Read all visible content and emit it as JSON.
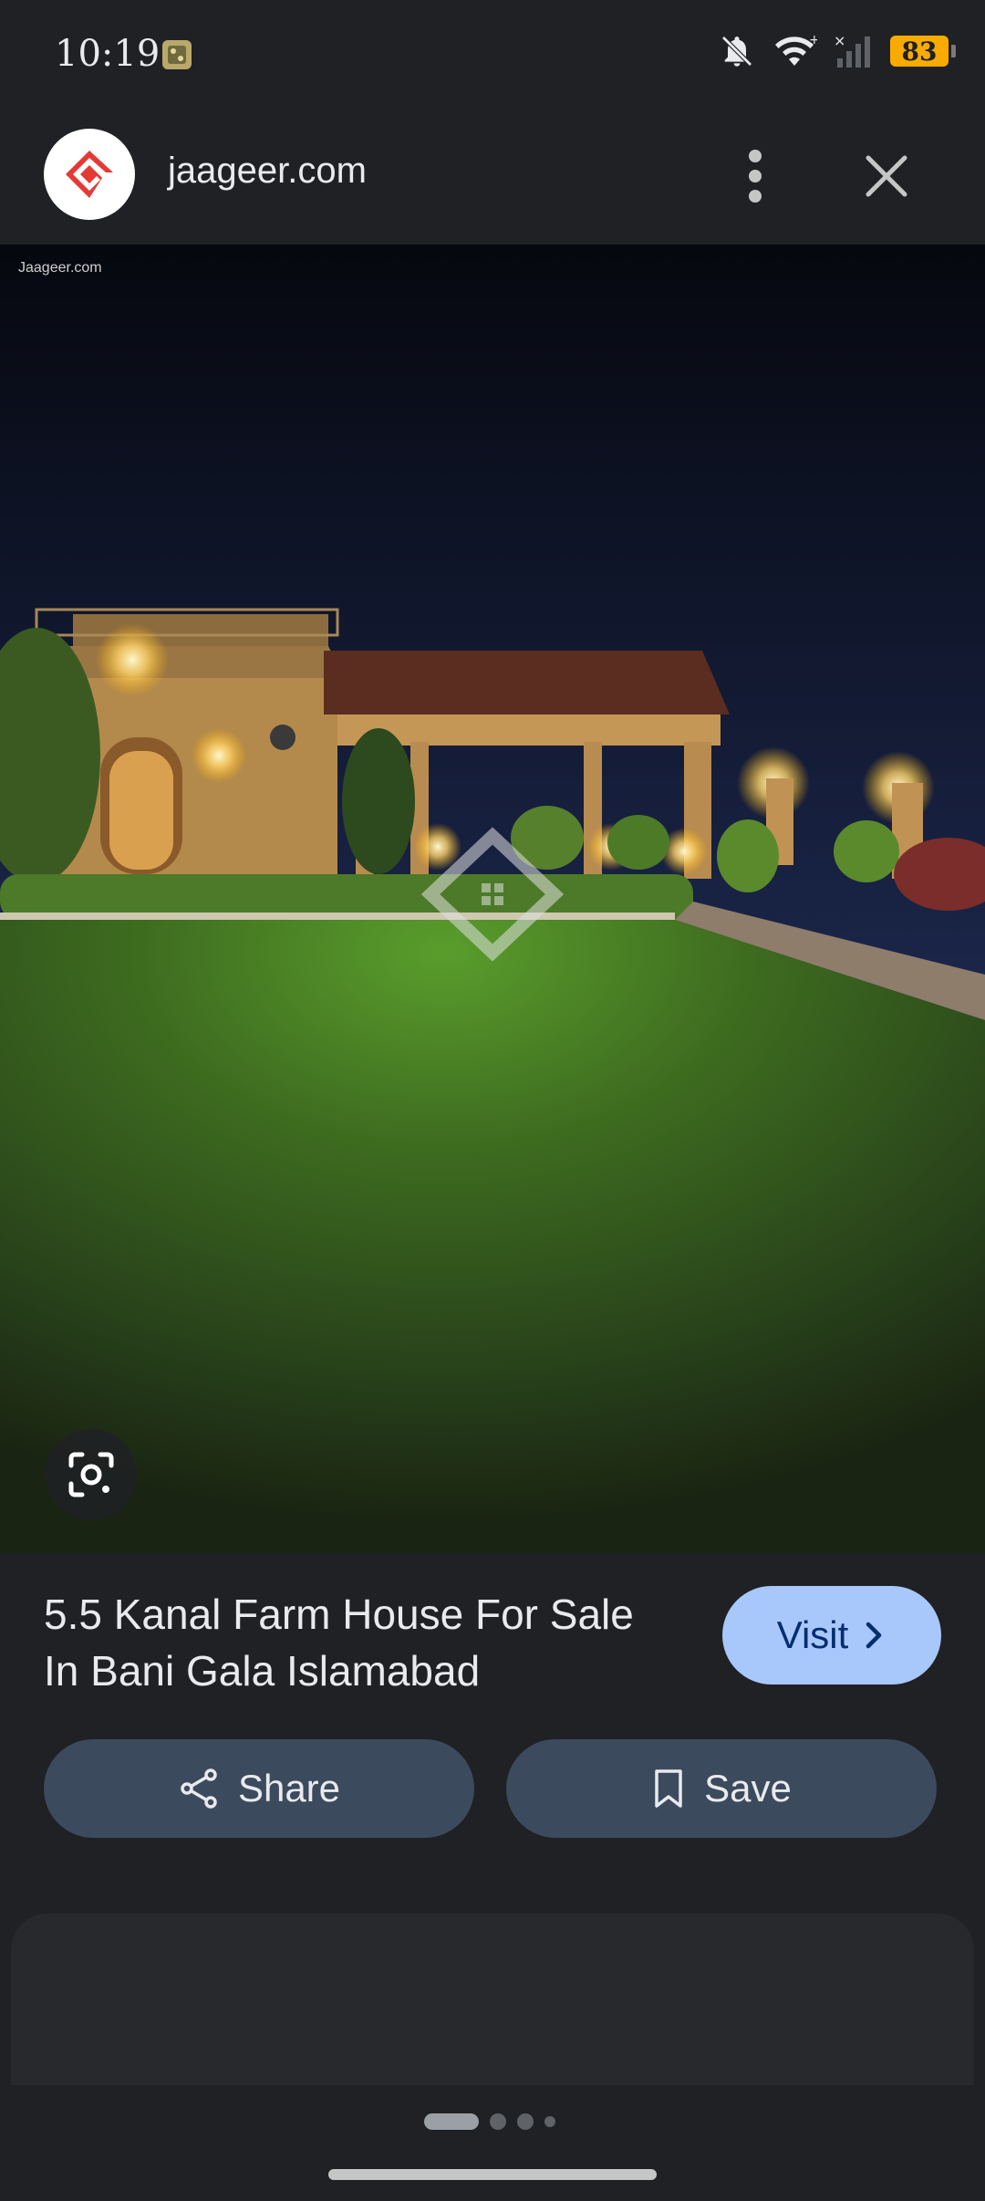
{
  "status_bar": {
    "time": "10:19",
    "battery": "83",
    "icons": [
      "notifications-muted-icon",
      "wifi-icon",
      "signal-off-icon",
      "battery-icon"
    ]
  },
  "header": {
    "site_name": "jaageer.com",
    "logo_icon": "jaageer-logo",
    "more_icon": "more-vert-icon",
    "close_icon": "close-icon"
  },
  "image": {
    "watermark": "Jaageer.com"
  },
  "result": {
    "title_line1": "5.5 Kanal Farm House For Sale",
    "title_line2": "In Bani Gala Islamabad",
    "visit_label": "Visit"
  },
  "actions": {
    "share_label": "Share",
    "save_label": "Save"
  },
  "pagination": {
    "current": 1,
    "total": 4
  },
  "colors": {
    "background": "#202124",
    "visit_button": "#a8c7fa",
    "action_button": "#3c4a5e",
    "battery": "#f9ab00",
    "logo_red": "#e53935"
  }
}
